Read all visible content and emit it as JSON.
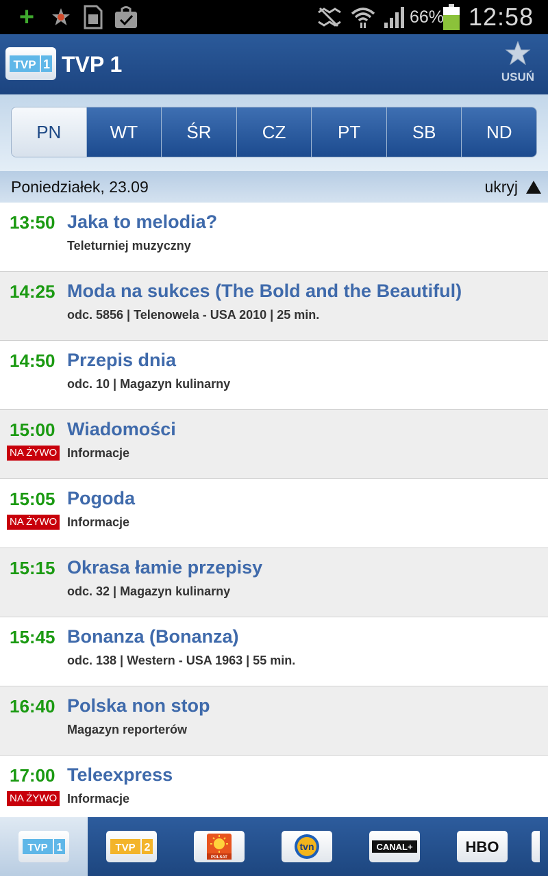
{
  "status_bar": {
    "battery_percent": "66%",
    "time": "12:58",
    "icons": [
      "plus-icon",
      "star-badge-icon",
      "sim-card-icon",
      "shopping-bag-icon",
      "mute-icon",
      "wifi-icon",
      "signal-icon",
      "battery-icon"
    ]
  },
  "header": {
    "channel_title": "TVP 1",
    "logo_text": "TVP",
    "logo_number": "1",
    "remove_label": "USUŃ"
  },
  "day_tabs": [
    {
      "label": "PN",
      "active": true
    },
    {
      "label": "WT",
      "active": false
    },
    {
      "label": "ŚR",
      "active": false
    },
    {
      "label": "CZ",
      "active": false
    },
    {
      "label": "PT",
      "active": false
    },
    {
      "label": "SB",
      "active": false
    },
    {
      "label": "ND",
      "active": false
    }
  ],
  "date_bar": {
    "date": "Poniedziałek, 23.09",
    "hide_label": "ukryj"
  },
  "live_label": "NA ŻYWO",
  "programs": [
    {
      "time": "13:50",
      "title": "Jaka to melodia?",
      "desc": "Teleturniej muzyczny",
      "live": false
    },
    {
      "time": "14:25",
      "title": "Moda na sukces (The Bold and the Beautiful)",
      "desc": "odc. 5856 | Telenowela - USA 2010 | 25 min.",
      "live": false
    },
    {
      "time": "14:50",
      "title": "Przepis dnia",
      "desc": "odc. 10 | Magazyn kulinarny",
      "live": false
    },
    {
      "time": "15:00",
      "title": "Wiadomości",
      "desc": "Informacje",
      "live": true
    },
    {
      "time": "15:05",
      "title": "Pogoda",
      "desc": "Informacje",
      "live": true
    },
    {
      "time": "15:15",
      "title": "Okrasa łamie przepisy",
      "desc": "odc. 32 | Magazyn kulinarny",
      "live": false
    },
    {
      "time": "15:45",
      "title": "Bonanza (Bonanza)",
      "desc": "odc. 138 | Western - USA 1963 | 55 min.",
      "live": false
    },
    {
      "time": "16:40",
      "title": "Polska non stop",
      "desc": "Magazyn reporterów",
      "live": false
    },
    {
      "time": "17:00",
      "title": "Teleexpress",
      "desc": "Informacje",
      "live": true
    }
  ],
  "channels": {
    "tvp1": {
      "text": "TVP",
      "num": "1"
    },
    "tvp2": {
      "text": "TVP",
      "num": "2"
    },
    "polsat": {
      "text": "POLSAT"
    },
    "tvn": {
      "text": "tvn"
    },
    "canal": {
      "text": "CANAL+"
    },
    "hbo": {
      "text": "HBO"
    }
  },
  "colors": {
    "header_blue": "#1c4480",
    "time_green": "#1b9a12",
    "title_blue": "#3f6aab",
    "live_red": "#c8000b"
  }
}
